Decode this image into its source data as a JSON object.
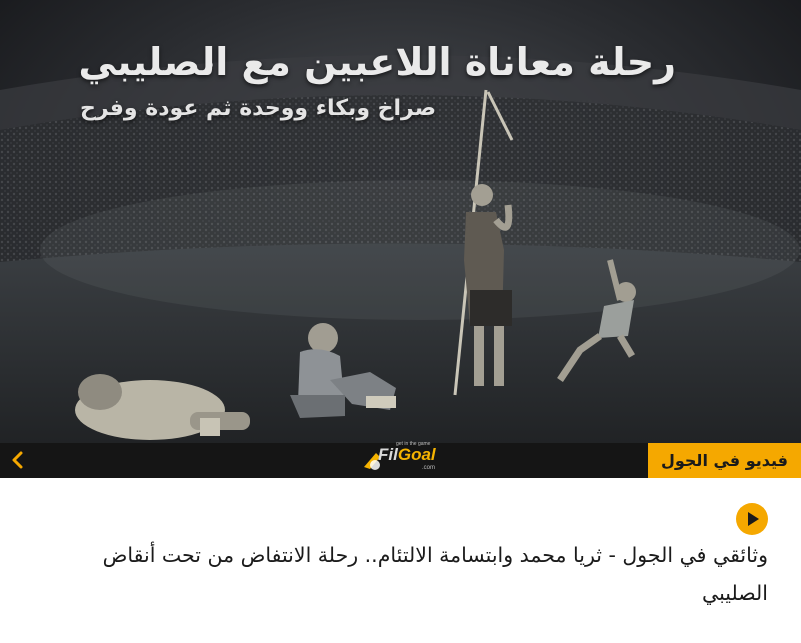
{
  "hero": {
    "title": "رحلة معاناة اللاعبين مع الصليبي",
    "subtitle": "صراخ وبكاء ووحدة ثم عودة وفرح"
  },
  "logo": {
    "name_main": "Fil",
    "name_accent": "Goal",
    "tagline": "get in the game",
    "domain": ".com"
  },
  "category_tag": "فيديو في الجول",
  "headline": "وثائقي في الجول - ثريا محمد وابتسامة الالتئام.. رحلة الانتفاض من تحت أنقاض الصليبي",
  "icons": {
    "prev": "chevron-left-icon",
    "play": "play-icon"
  },
  "colors": {
    "accent": "#f5a800",
    "bar": "#151515",
    "text": "#1b1b1b"
  }
}
